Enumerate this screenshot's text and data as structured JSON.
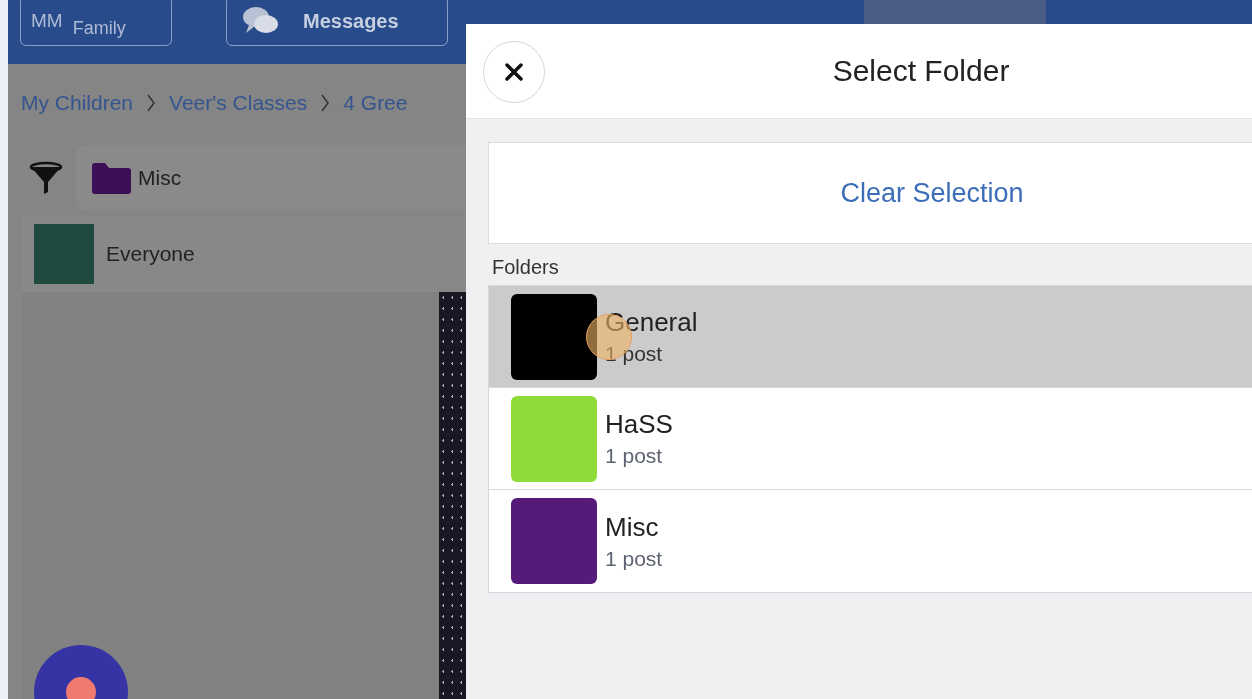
{
  "top_bar": {
    "account": {
      "initials": "MM",
      "name_line_2": "Family"
    },
    "messages_button": "Messages"
  },
  "breadcrumbs": [
    "My Children",
    "Veer's Classes",
    "4 Gree"
  ],
  "filter": {
    "folder": "Misc"
  },
  "audience": {
    "label": "Everyone"
  },
  "modal": {
    "title": "Select Folder",
    "clear_button": "Clear Selection",
    "section_label": "Folders",
    "folders": [
      {
        "name": "General",
        "count": "1 post",
        "color": "#000000",
        "selected": true
      },
      {
        "name": "HaSS",
        "count": "1 post",
        "color": "#8fdc38",
        "selected": false
      },
      {
        "name": "Misc",
        "count": "1 post",
        "color": "#561a7a",
        "selected": false
      }
    ]
  }
}
